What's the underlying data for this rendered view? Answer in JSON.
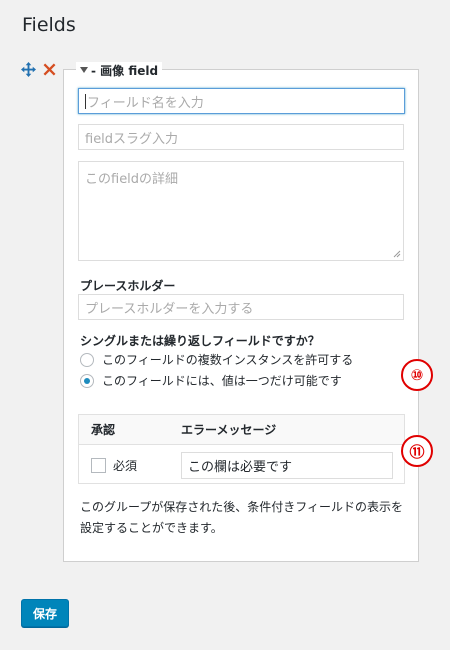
{
  "page": {
    "title": "Fields"
  },
  "field": {
    "legend": "- 画像 field",
    "name_placeholder": "フィールド名を入力",
    "slug_placeholder": "fieldスラグ入力",
    "description_placeholder": "このfieldの詳細",
    "placeholder_label": "プレースホルダー",
    "placeholder_placeholder": "プレースホルダーを入力する",
    "repeat_question": "シングルまたは繰り返しフィールドですか？",
    "repeat_options": [
      {
        "label": "このフィールドの複数インスタンスを許可する",
        "checked": false
      },
      {
        "label": "このフィールドには、値は一つだけ可能です",
        "checked": true
      }
    ],
    "validation": {
      "col_validation": "承認",
      "col_error": "エラーメッセージ",
      "required_label": "必須",
      "error_message": "この欄は必要です"
    },
    "note": "このグループが保存された後、条件付きフィールドの表示を設定することができます。"
  },
  "annotations": {
    "badge_10": "⑩",
    "badge_11": "⑪"
  },
  "actions": {
    "save_label": "保存"
  },
  "icons": {
    "move": "move-icon",
    "delete": "delete-icon",
    "toggle": "triangle-down-icon"
  },
  "colors": {
    "accent": "#0085ba",
    "delete": "#d54e21",
    "move": "#2271b1",
    "annotation": "#e00000"
  }
}
